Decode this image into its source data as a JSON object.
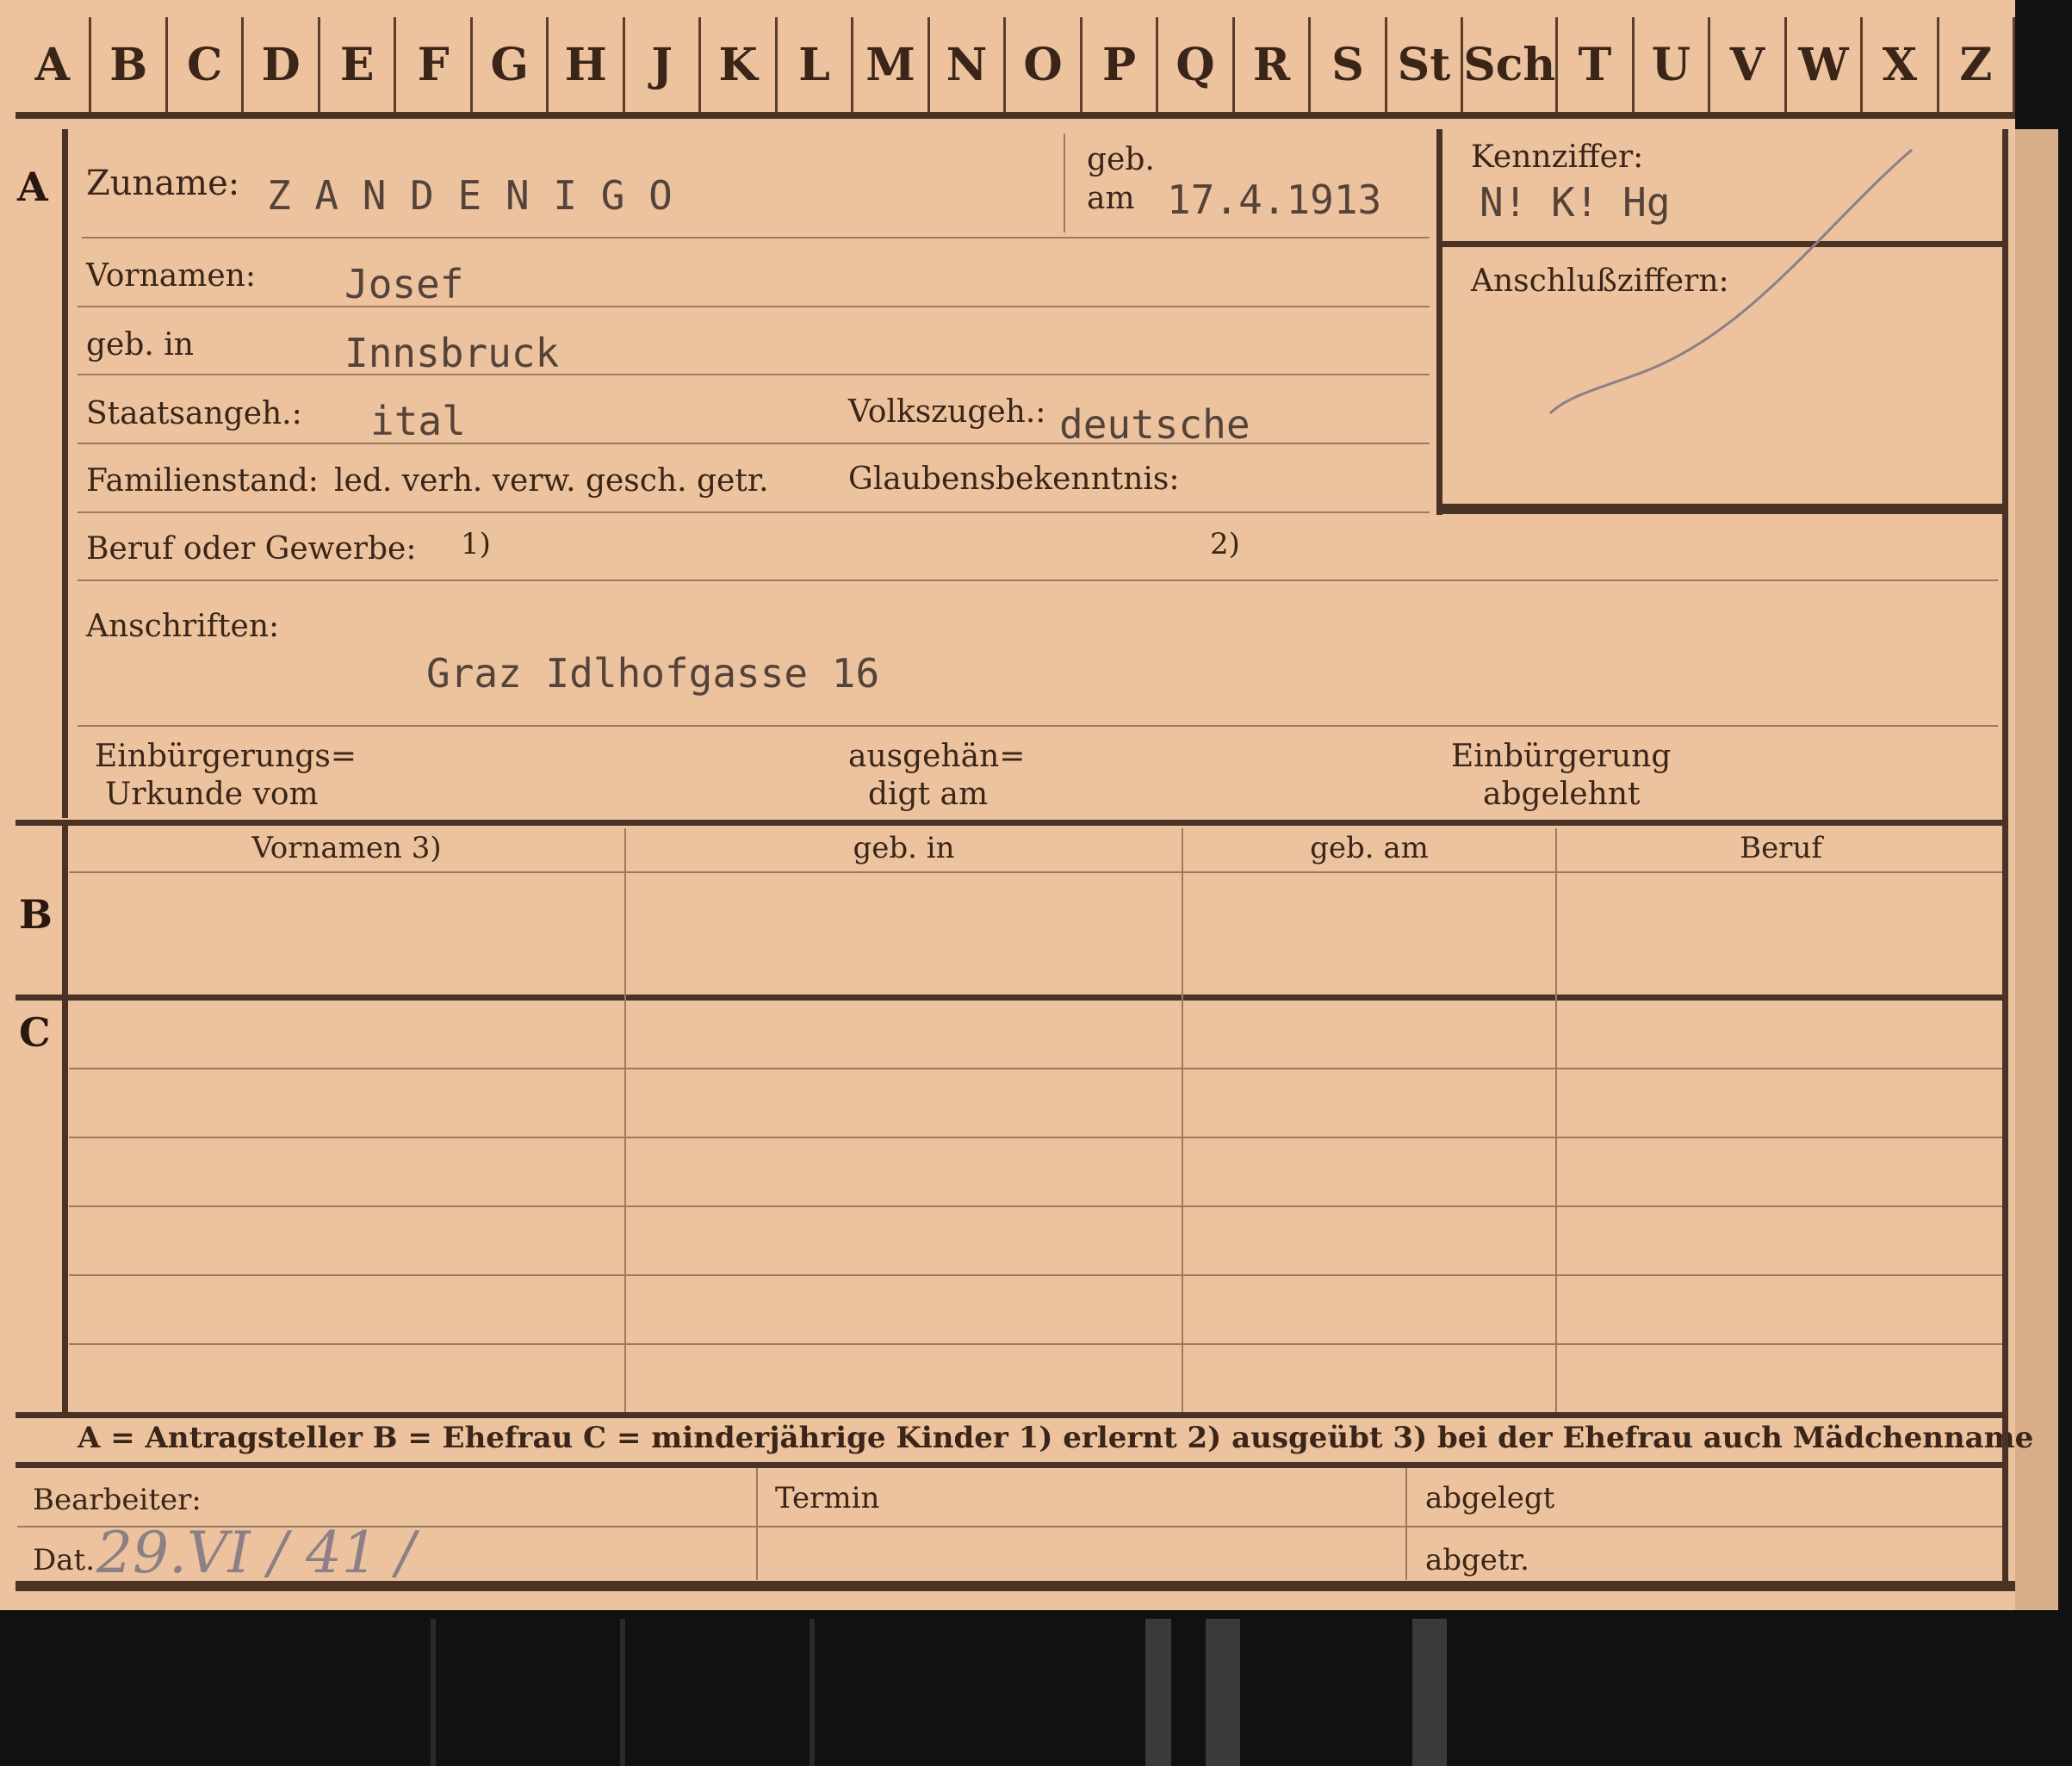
{
  "alphabet": [
    "A",
    "B",
    "C",
    "D",
    "E",
    "F",
    "G",
    "H",
    "J",
    "K",
    "L",
    "M",
    "N",
    "O",
    "P",
    "Q",
    "R",
    "S",
    "St",
    "Sch",
    "T",
    "U",
    "V",
    "W",
    "X",
    "Z"
  ],
  "section_a": {
    "letter": "A",
    "zuname_label": "Zuname:",
    "zuname_value": "Z A N D E N I G O",
    "geb_label": "geb.",
    "am_label": "am",
    "geb_am_value": "17.4.1913",
    "vornamen_label": "Vornamen:",
    "vornamen_value": "Josef",
    "geb_in_label": "geb. in",
    "geb_in_value": "Innsbruck",
    "staatsangeh_label": "Staatsangeh.:",
    "staatsangeh_value": "ital",
    "volkszugeh_label": "Volkszugeh.:",
    "volkszugeh_value": "deutsche",
    "familienstand_label": "Familienstand:",
    "familienstand_options": "led. verh. verw. gesch. getr.",
    "glaubens_label": "Glaubensbekenntnis:",
    "beruf_label": "Beruf oder Gewerbe:",
    "beruf_mark1": "1)",
    "beruf_mark2": "2)",
    "anschriften_label": "Anschriften:",
    "anschriften_value": "Graz Idlhofgasse 16",
    "einbuergerungs_label_1": "Einbürgerungs=",
    "einbuergerungs_label_2": "Urkunde vom",
    "ausgehaen_label_1": "ausgehän=",
    "ausgehaen_label_2": "digt am",
    "einbuergerung_label_1": "Einbürgerung",
    "einbuergerung_label_2": "abgelehnt"
  },
  "kennziffer": {
    "label": "Kennziffer:",
    "value": "N! K! Hg",
    "anschluss_label": "Anschlußziffern:"
  },
  "section_b": {
    "letter": "B",
    "columns": [
      "Vornamen 3)",
      "geb. in",
      "geb. am",
      "Beruf"
    ]
  },
  "section_c": {
    "letter": "C"
  },
  "legend": "A = Antragsteller   B = Ehefrau   C = minderjährige Kinder   1) erlernt   2) ausgeübt   3) bei der Ehefrau auch Mädchenname",
  "footer": {
    "bearbeiter_label": "Bearbeiter:",
    "dat_label": "Dat.",
    "dat_value": "29.VI / 41 /",
    "termin_label": "Termin",
    "abgelegt_label": "abgelegt",
    "abgetr_label": "abgetr."
  },
  "colors": {
    "card": "#ecc39e",
    "ink": "#3a2518",
    "typewriter": "#55433a",
    "pencil": "#8d7f86"
  }
}
